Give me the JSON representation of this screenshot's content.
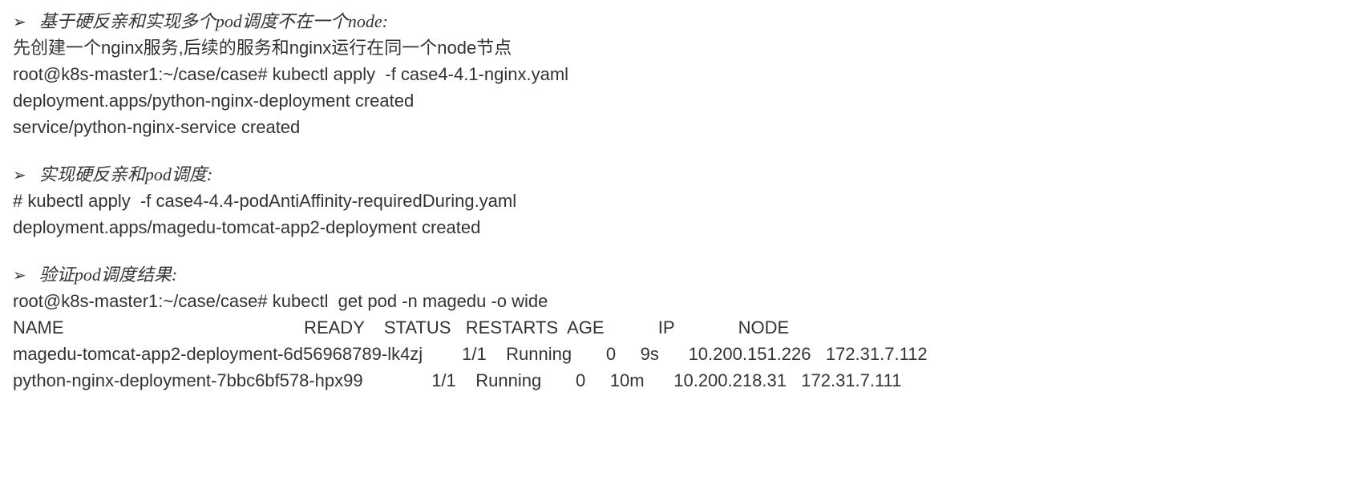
{
  "section1": {
    "bullet_marker": "➢",
    "heading": "基于硬反亲和实现多个pod调度不在一个node:",
    "desc": "先创建一个nginx服务,后续的服务和nginx运行在同一个node节点",
    "cmd1": "root@k8s-master1:~/case/case# kubectl apply  -f case4-4.1-nginx.yaml",
    "out1": "deployment.apps/python-nginx-deployment created",
    "out2": "service/python-nginx-service created"
  },
  "section2": {
    "bullet_marker": "➢",
    "heading": "实现硬反亲和pod调度:",
    "cmd1": "# kubectl apply  -f case4-4.4-podAntiAffinity-requiredDuring.yaml",
    "out1": "deployment.apps/magedu-tomcat-app2-deployment created"
  },
  "section3": {
    "bullet_marker": "➢",
    "heading": "验证pod调度结果:",
    "cmd1": "root@k8s-master1:~/case/case# kubectl  get pod -n magedu -o wide",
    "table": {
      "headers": [
        "NAME",
        "READY",
        "STATUS",
        "RESTARTS",
        "AGE",
        "IP",
        "NODE"
      ],
      "rows": [
        {
          "name": "magedu-tomcat-app2-deployment-6d56968789-lk4zj",
          "ready": "1/1",
          "status": "Running",
          "restarts": "0",
          "age": "9s",
          "ip": "10.200.151.226",
          "node": "172.31.7.112"
        },
        {
          "name": "python-nginx-deployment-7bbc6bf578-hpx99",
          "ready": "1/1",
          "status": "Running",
          "restarts": "0",
          "age": "10m",
          "ip": "10.200.218.31",
          "node": "172.31.7.111"
        }
      ]
    }
  }
}
